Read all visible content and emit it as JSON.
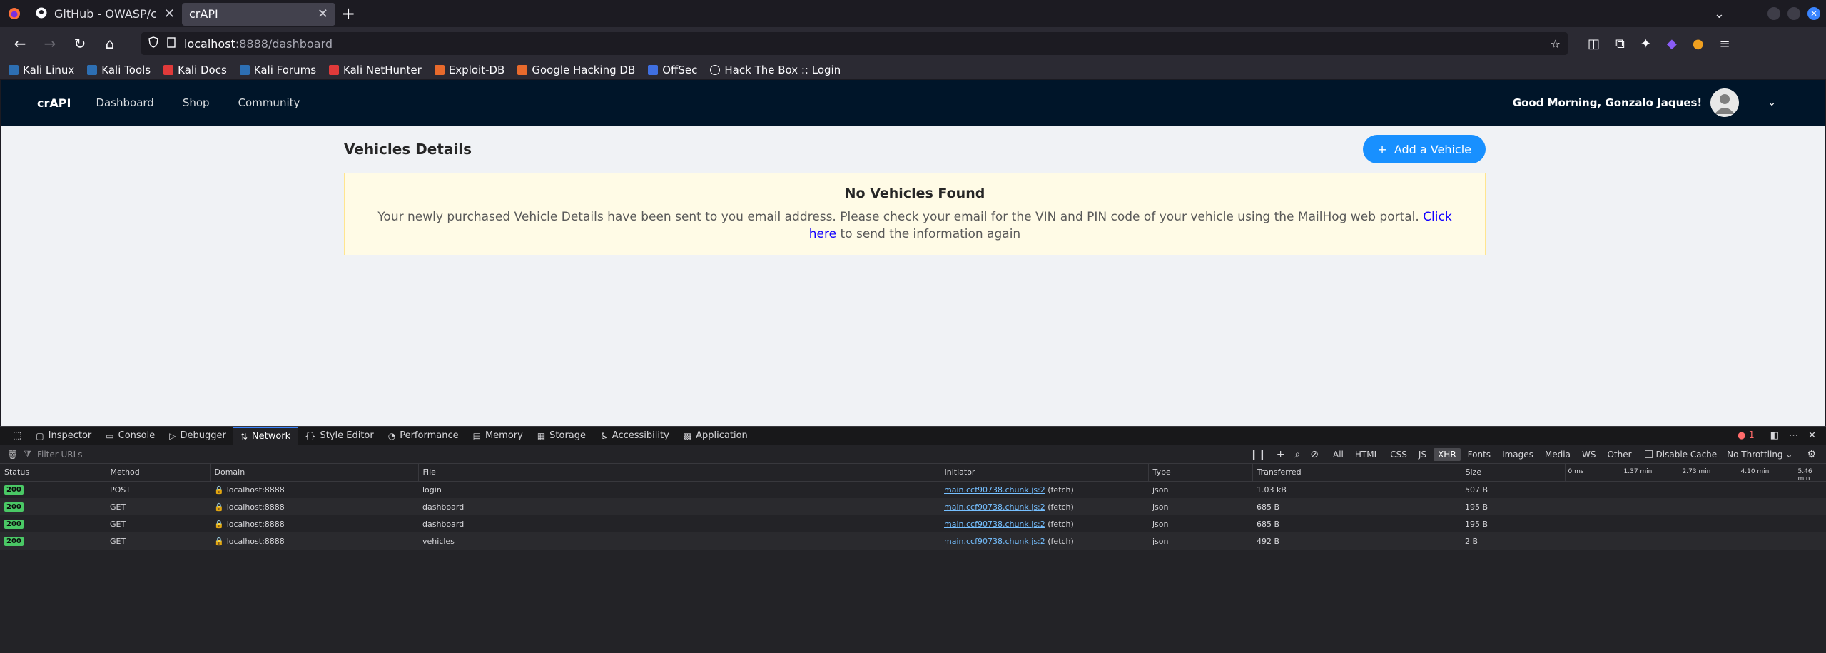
{
  "browser": {
    "tabs": [
      {
        "title": "GitHub - OWASP/crAPI: c",
        "active": false
      },
      {
        "title": "crAPI",
        "active": true
      }
    ],
    "url_host": "localhost",
    "url_path": ":8888/dashboard",
    "bookmarks": [
      {
        "label": "Kali Linux",
        "color": "#2d6fb3"
      },
      {
        "label": "Kali Tools",
        "color": "#2d6fb3"
      },
      {
        "label": "Kali Docs",
        "color": "#e03a3a"
      },
      {
        "label": "Kali Forums",
        "color": "#2d6fb3"
      },
      {
        "label": "Kali NetHunter",
        "color": "#e03a3a"
      },
      {
        "label": "Exploit-DB",
        "color": "#e86a2c"
      },
      {
        "label": "Google Hacking DB",
        "color": "#e86a2c"
      },
      {
        "label": "OffSec",
        "color": "#3f6fe0"
      },
      {
        "label": "Hack The Box :: Login",
        "color": "#888888"
      }
    ]
  },
  "app": {
    "brand": "crAPI",
    "menu": [
      "Dashboard",
      "Shop",
      "Community"
    ],
    "greeting": "Good Morning, Gonzalo Jaques!",
    "page_title": "Vehicles Details",
    "add_button": "Add a Vehicle",
    "alert": {
      "title": "No Vehicles Found",
      "desc_before": "Your newly purchased Vehicle Details have been sent to you email address. Please check your email for the VIN and PIN code of your vehicle using the MailHog web portal. ",
      "link": "Click here",
      "desc_after": " to send the information again"
    },
    "colors": {
      "header": "#001529",
      "primary": "#1890ff",
      "alert_bg": "#fffbe6"
    }
  },
  "devtools": {
    "tabs": [
      "Inspector",
      "Console",
      "Debugger",
      "Network",
      "Style Editor",
      "Performance",
      "Memory",
      "Storage",
      "Accessibility",
      "Application"
    ],
    "active_tab": "Network",
    "error_count": "1",
    "filter_placeholder": "Filter URLs",
    "type_filters": [
      "All",
      "HTML",
      "CSS",
      "JS",
      "XHR",
      "Fonts",
      "Images",
      "Media",
      "WS",
      "Other"
    ],
    "active_filter": "XHR",
    "disable_cache": "Disable Cache",
    "throttling": "No Throttling",
    "columns": [
      "Status",
      "Method",
      "Domain",
      "File",
      "Initiator",
      "Type",
      "Transferred",
      "Size"
    ],
    "waterfall_ticks": [
      "0 ms",
      "1.37 min",
      "2.73 min",
      "4.10 min",
      "5.46 min"
    ],
    "rows": [
      {
        "status": "200",
        "method": "POST",
        "domain": "localhost:8888",
        "file": "login",
        "initiator": "main.ccf90738.chunk.js:2",
        "initiator_kind": "(fetch)",
        "type": "json",
        "transferred": "1.03 kB",
        "size": "507 B"
      },
      {
        "status": "200",
        "method": "GET",
        "domain": "localhost:8888",
        "file": "dashboard",
        "initiator": "main.ccf90738.chunk.js:2",
        "initiator_kind": "(fetch)",
        "type": "json",
        "transferred": "685 B",
        "size": "195 B"
      },
      {
        "status": "200",
        "method": "GET",
        "domain": "localhost:8888",
        "file": "dashboard",
        "initiator": "main.ccf90738.chunk.js:2",
        "initiator_kind": "(fetch)",
        "type": "json",
        "transferred": "685 B",
        "size": "195 B"
      },
      {
        "status": "200",
        "method": "GET",
        "domain": "localhost:8888",
        "file": "vehicles",
        "initiator": "main.ccf90738.chunk.js:2",
        "initiator_kind": "(fetch)",
        "type": "json",
        "transferred": "492 B",
        "size": "2 B"
      }
    ]
  }
}
